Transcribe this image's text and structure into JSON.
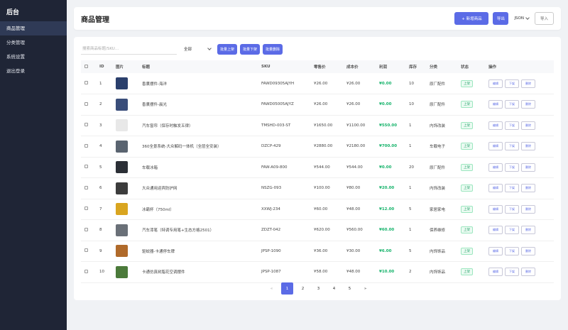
{
  "sidebar": {
    "brand": "后台",
    "items": [
      {
        "label": "商品管理",
        "active": true
      },
      {
        "label": "分类管理",
        "active": false
      },
      {
        "label": "系统设置",
        "active": false
      },
      {
        "label": "退出登录",
        "active": false
      }
    ]
  },
  "header": {
    "title": "商品管理",
    "new_label": "+ 新增商品",
    "export_label": "导出",
    "format_value": "JSON",
    "import_label": "导入"
  },
  "filters": {
    "search_placeholder": "搜索商品标题/SKU...",
    "status_value": "全部",
    "batch_on_label": "批量上架",
    "batch_off_label": "批量下架",
    "batch_delete_label": "批量删除"
  },
  "table": {
    "headers": [
      "ID",
      "图片",
      "标题",
      "SKU",
      "零售价",
      "成本价",
      "利润",
      "库存",
      "分类",
      "状态",
      "操作"
    ],
    "rows": [
      {
        "id": "1",
        "title": "香薰摆件-海洋",
        "sku": "FAWD09305AJYH",
        "retail": "¥26.00",
        "cost": "¥26.00",
        "profit": "¥0.00",
        "stock": "10",
        "category": "原厂配件",
        "status": "上架",
        "thumb_color": "#2a3f6c"
      },
      {
        "id": "2",
        "title": "香薰摆件-晨光",
        "sku": "FAWD05005AJYZ",
        "retail": "¥26.00",
        "cost": "¥26.00",
        "profit": "¥0.00",
        "stock": "10",
        "category": "原厂配件",
        "status": "上架",
        "thumb_color": "#3a4e7a"
      },
      {
        "id": "3",
        "title": "汽车窗帘（保存时触发五律）",
        "sku": "TMSHD-003-ST",
        "retail": "¥1650.00",
        "cost": "¥1100.00",
        "profit": "¥550.00",
        "stock": "1",
        "category": "内饰改装",
        "status": "上架",
        "thumb_color": "#e8e8e8"
      },
      {
        "id": "4",
        "title": "360全景系统-大众解码一体机（全层全安装）",
        "sku": "DZCP-429",
        "retail": "¥2880.00",
        "cost": "¥2180.00",
        "profit": "¥700.00",
        "stock": "1",
        "category": "车载电子",
        "status": "上架",
        "thumb_color": "#5a6470"
      },
      {
        "id": "5",
        "title": "车载冰箱",
        "sku": "FAW-A09-800",
        "retail": "¥544.00",
        "cost": "¥544.00",
        "profit": "¥0.00",
        "stock": "20",
        "category": "原厂配件",
        "status": "上架",
        "thumb_color": "#2b2f36"
      },
      {
        "id": "6",
        "title": "大众通用迎宾防护网",
        "sku": "NSZG-093",
        "retail": "¥100.00",
        "cost": "¥80.00",
        "profit": "¥20.00",
        "stock": "1",
        "category": "内饰改装",
        "status": "上架",
        "thumb_color": "#3c3c3c"
      },
      {
        "id": "7",
        "title": "冰霸杯（750ml）",
        "sku": "XXWJ-234",
        "retail": "¥60.00",
        "cost": "¥48.00",
        "profit": "¥12.00",
        "stock": "5",
        "category": "家居家电",
        "status": "上架",
        "thumb_color": "#d9a520"
      },
      {
        "id": "8",
        "title": "汽车漆笔（特调专用笔+生态方格2501）",
        "sku": "ZDZT-042",
        "retail": "¥620.00",
        "cost": "¥560.00",
        "profit": "¥60.00",
        "stock": "1",
        "category": "保养维修",
        "status": "上架",
        "thumb_color": "#6a7078"
      },
      {
        "id": "9",
        "title": "驱蚊器-卡通停车牌",
        "sku": "JPSP-1090",
        "retail": "¥36.00",
        "cost": "¥30.00",
        "profit": "¥6.00",
        "stock": "5",
        "category": "内饰饰品",
        "status": "上架",
        "thumb_color": "#b06a2a"
      },
      {
        "id": "10",
        "title": "卡通仿真树脂花空调摆件",
        "sku": "JPSP-1087",
        "retail": "¥58.00",
        "cost": "¥48.00",
        "profit": "¥10.00",
        "stock": "2",
        "category": "内饰饰品",
        "status": "上架",
        "thumb_color": "#4b7a3a"
      }
    ],
    "op_labels": [
      "编辑",
      "下架",
      "删除"
    ]
  },
  "pagination": {
    "prev": "«",
    "pages": [
      "1",
      "2",
      "3",
      "4",
      "5"
    ],
    "active_index": 0,
    "next": "»"
  },
  "colors": {
    "sidebar_bg": "#1f2536",
    "accent": "#5b6be6",
    "profit_green": "#16b36b"
  }
}
